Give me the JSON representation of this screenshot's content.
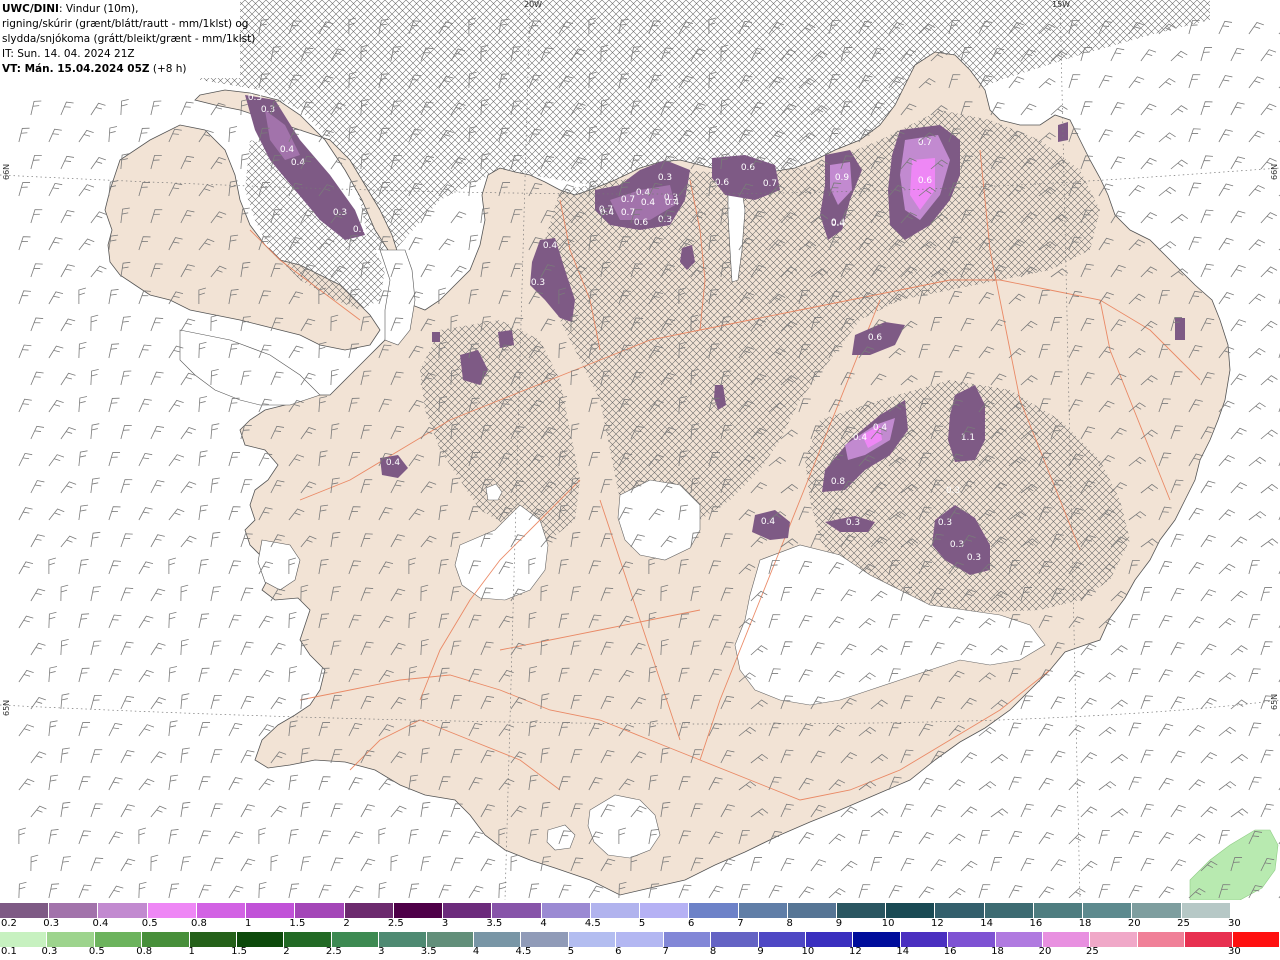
{
  "title": {
    "product": "UWC/DINI",
    "line1_rest": ": Vindur (10m),",
    "line2": "rigning/skúrir (grænt/blátt/rautt - mm/1klst) og",
    "line3": "slydda/snjókoma (grátt/bleikt/grænt - mm/1klst)",
    "issue": "IT: Sun. 14. 04. 2024 21Z",
    "valid_prefix": "VT: Mán. 15.04.2024 05Z",
    "valid_suffix": " (+8 h)"
  },
  "graticule": {
    "lon_labels": [
      "20W",
      "15W"
    ],
    "lat_labels": [
      "66N",
      "66N",
      "65N",
      "65N"
    ]
  },
  "precip_values": [
    "0.3",
    "0.3",
    "0.4",
    "0.4",
    "0.3",
    "0.7",
    "0.7",
    "0.4",
    "0.3",
    "0.4",
    "0.3",
    "0.4",
    "0.6",
    "0.7",
    "0.7",
    "0.4",
    "0.3",
    "0.6",
    "0.6",
    "0.7",
    "0.4",
    "0.9",
    "0.4",
    "0.7",
    "0.6",
    "0.4",
    "0.3",
    "0.6",
    "0.4",
    "0.4",
    "0.8",
    "1.1",
    "0.4",
    "0.4",
    "0.3",
    "0.3",
    "0.3",
    "0.3",
    "0.3"
  ],
  "snow_scale": {
    "labels": [
      "0.2",
      "0.3",
      "0.4",
      "0.5",
      "0.8",
      "1",
      "1.5",
      "2",
      "2.5",
      "3",
      "3.5",
      "4",
      "4.5",
      "5",
      "6",
      "7",
      "8",
      "9",
      "10",
      "12",
      "14",
      "16",
      "18",
      "20",
      "25",
      "30"
    ],
    "colors": [
      "#7e5a85",
      "#a273ab",
      "#c28ad0",
      "#ee87f5",
      "#d262e4",
      "#c152d8",
      "#a446b8",
      "#6c2a6e",
      "#4e0048",
      "#6c2b7c",
      "#8754a9",
      "#9b8ad3",
      "#b1b3ee",
      "#b5b1f4",
      "#6d82c8",
      "#607ea7",
      "#567595",
      "#2a5661",
      "#1a4a54",
      "#335f6c",
      "#3d6b72",
      "#4e7d80",
      "#5d8a8e",
      "#7e9e9f",
      "#b6c8c6",
      "#ffffff"
    ]
  },
  "rain_scale": {
    "labels": [
      "0.1",
      "0.3",
      "0.5",
      "0.8",
      "1",
      "1.5",
      "2",
      "2.5",
      "3",
      "3.5",
      "4",
      "4.5",
      "5",
      "6",
      "7",
      "8",
      "9",
      "10",
      "12",
      "14",
      "16",
      "18",
      "20",
      "25",
      "30"
    ],
    "colors": [
      "#c7f1c0",
      "#9dd48d",
      "#6cb35d",
      "#478f3a",
      "#25611a",
      "#0d4a0b",
      "#226a25",
      "#3d8a52",
      "#4e8a72",
      "#628f7a",
      "#7996a6",
      "#909bb8",
      "#b3bdf0",
      "#b3b7f2",
      "#8287d7",
      "#6463c4",
      "#4e47c4",
      "#3a2fbf",
      "#000d9b",
      "#4a2fc0",
      "#7e52d3",
      "#b07ae0",
      "#e890e0",
      "#f0a8c8",
      "#f08098",
      "#e83050",
      "#ff1010"
    ]
  }
}
